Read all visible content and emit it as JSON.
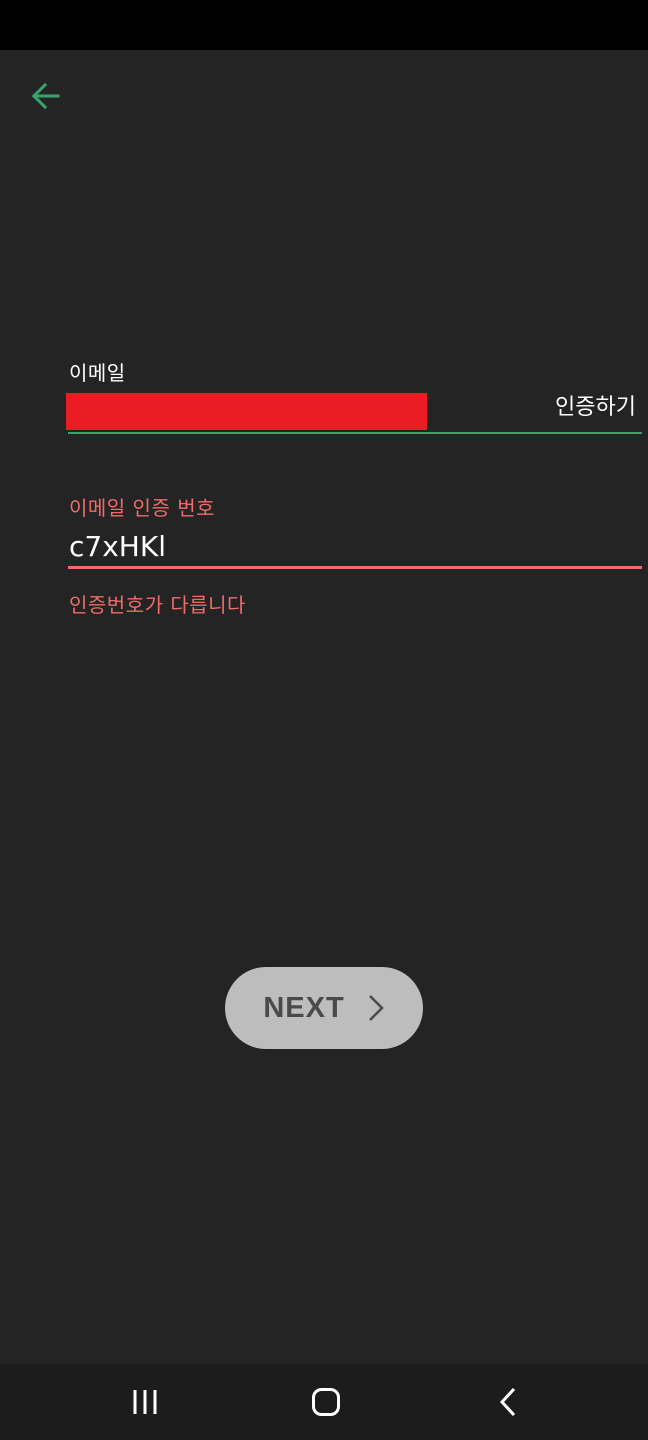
{
  "colors": {
    "background": "#242424",
    "accent_green": "#3aa36b",
    "error_red": "#ee6c6a",
    "redaction_red": "#ec1c24",
    "button_gray": "#bdbdbd"
  },
  "header": {
    "back_icon": "arrow-left-icon"
  },
  "email_field": {
    "label": "이메일",
    "value_redacted": true,
    "verify_button_label": "인증하기"
  },
  "code_field": {
    "label": "이메일 인증 번호",
    "value": "c7xHKl",
    "error": "인증번호가 다릅니다"
  },
  "next_button": {
    "label": "NEXT",
    "icon": "chevron-right-icon"
  },
  "system_nav": {
    "recents_icon": "recents-icon",
    "home_icon": "home-icon",
    "back_icon": "back-chevron-icon"
  }
}
